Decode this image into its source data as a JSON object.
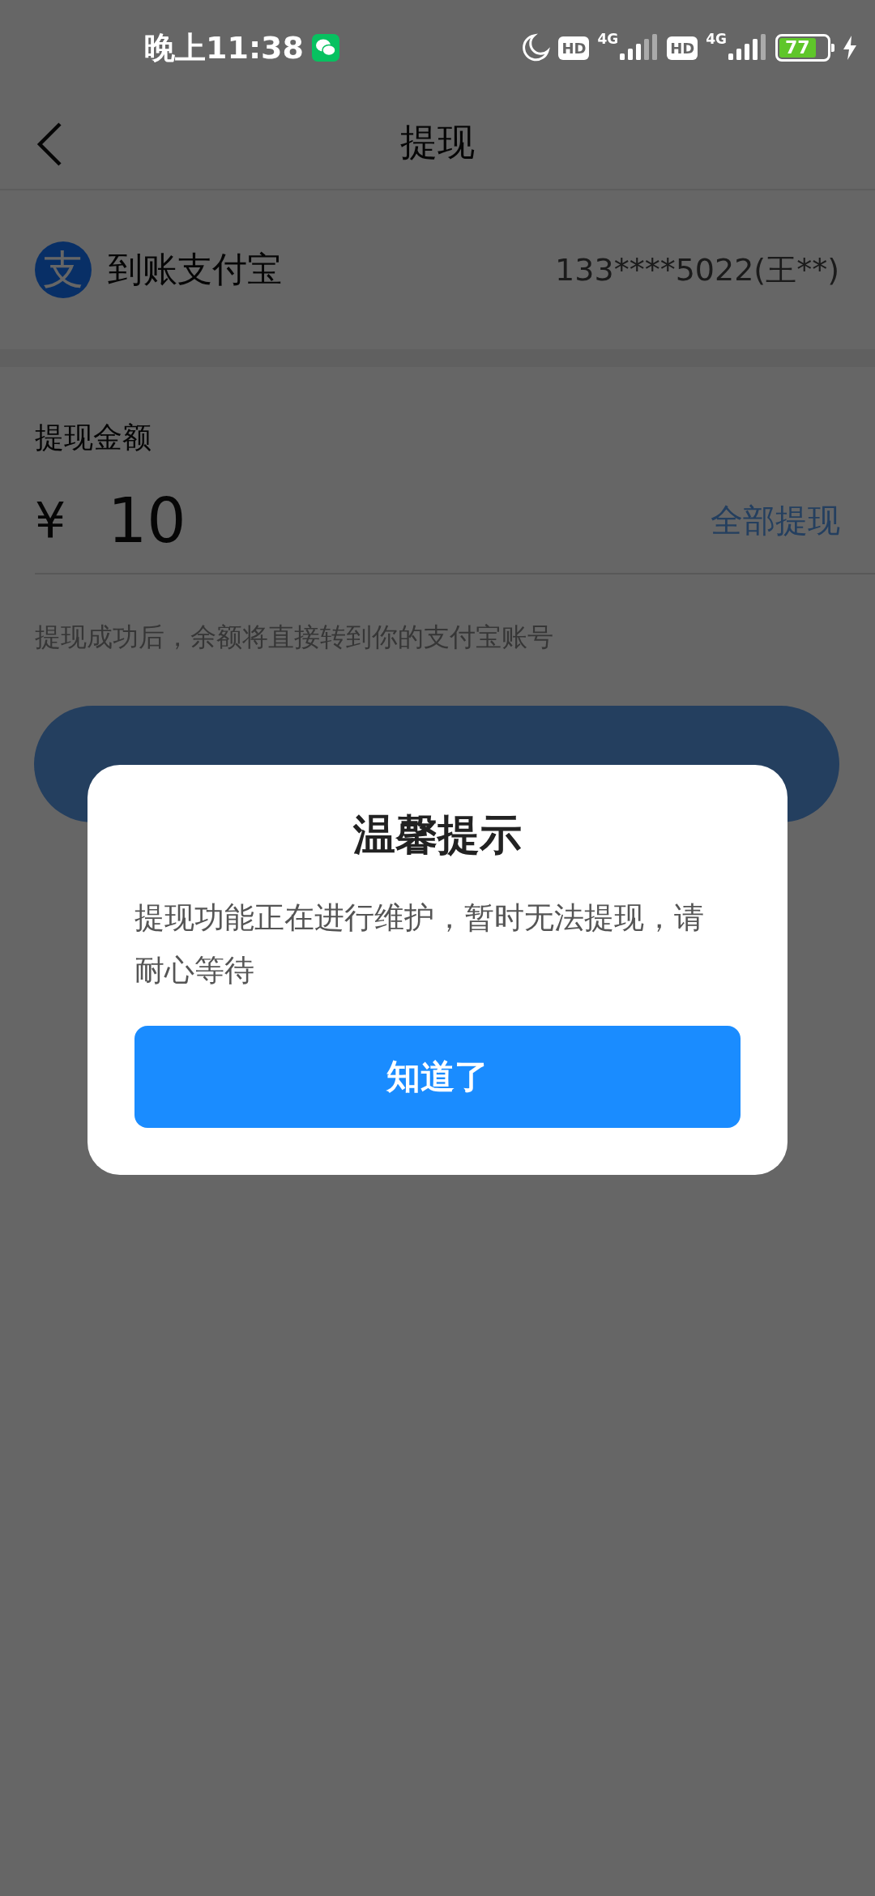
{
  "status_bar": {
    "time": "晚上11:38",
    "hd_badges": [
      "HD",
      "HD"
    ],
    "network": [
      "4G",
      "4G"
    ],
    "battery": "77",
    "charging": true
  },
  "header": {
    "title": "提现"
  },
  "account": {
    "logo_char": "支",
    "label": "到账支付宝",
    "number": "133****5022(王**)"
  },
  "form": {
    "amount_label": "提现金额",
    "currency": "¥",
    "amount": "10",
    "withdraw_all": "全部提现",
    "hint": "提现成功后，余额将直接转到你的支付宝账号"
  },
  "dialog": {
    "title": "温馨提示",
    "message": "提现功能正在进行维护，暂时无法提现，请耐心等待",
    "button": "知道了"
  }
}
